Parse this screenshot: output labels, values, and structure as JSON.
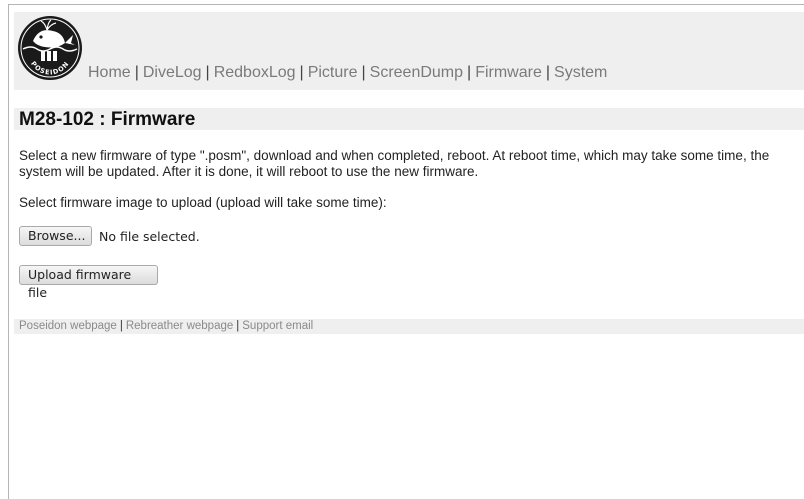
{
  "header": {
    "logo_text": "POSEIDON",
    "nav": [
      {
        "label": "Home"
      },
      {
        "label": "DiveLog"
      },
      {
        "label": "RedboxLog"
      },
      {
        "label": "Picture"
      },
      {
        "label": "ScreenDump"
      },
      {
        "label": "Firmware"
      },
      {
        "label": "System"
      }
    ],
    "separator": "|"
  },
  "page": {
    "title": "M28-102 : Firmware",
    "description": "Select a new firmware of type \".posm\", download and when completed, reboot. At reboot time, which may take some time, the system will be updated. After it is done, it will reboot to use the new firmware.",
    "select_prompt": "Select firmware image to upload (upload will take some time):"
  },
  "file_input": {
    "browse_label": "Browse...",
    "status": "No file selected."
  },
  "upload": {
    "label": "Upload firmware file"
  },
  "footer": {
    "links": [
      {
        "label": "Poseidon webpage"
      },
      {
        "label": "Rebreather webpage"
      },
      {
        "label": "Support email"
      }
    ],
    "separator": "|"
  },
  "colors": {
    "band_bg": "#efefef",
    "nav_link": "#7a7a7a",
    "footer_link": "#8a8a8a"
  }
}
